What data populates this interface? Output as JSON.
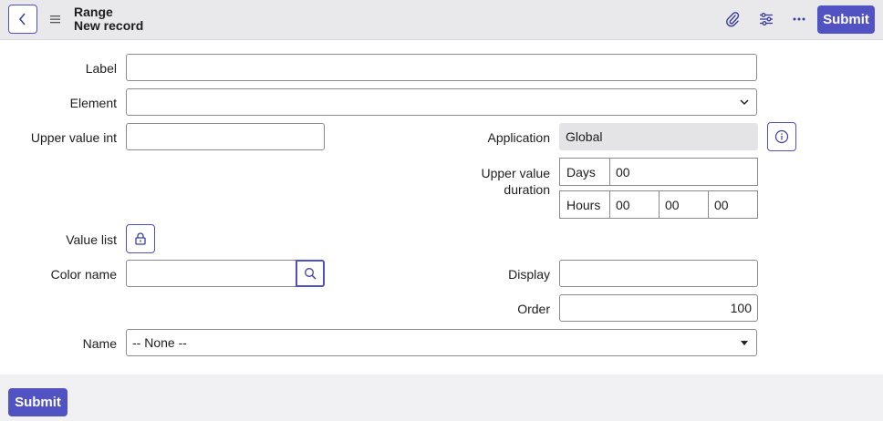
{
  "header": {
    "title": "Range",
    "subtitle": "New record",
    "submit_label": "Submit",
    "icons": [
      "chevron-left-icon",
      "hamburger-menu-icon",
      "paperclip-icon",
      "sliders-icon",
      "more-icon"
    ]
  },
  "form": {
    "label_field": {
      "label": "Label",
      "value": ""
    },
    "element_field": {
      "label": "Element",
      "value": ""
    },
    "upper_value_int": {
      "label": "Upper value int",
      "value": ""
    },
    "application": {
      "label": "Application",
      "value": "Global"
    },
    "upper_value_duration": {
      "label_line1": "Upper value",
      "label_line2": "duration",
      "days_label": "Days",
      "days_value": "00",
      "hours_label": "Hours",
      "hours_value": "00",
      "minutes_value": "00",
      "seconds_value": "00"
    },
    "value_list": {
      "label": "Value list"
    },
    "color_name": {
      "label": "Color name",
      "value": ""
    },
    "display": {
      "label": "Display",
      "value": ""
    },
    "order": {
      "label": "Order",
      "value": "100"
    },
    "name": {
      "label": "Name",
      "value": "-- None --"
    }
  },
  "footer": {
    "submit_label": "Submit"
  },
  "colors": {
    "accent": "#5253c3",
    "header_bg": "#e9e9ec",
    "readonly_bg": "#e4e4e7"
  }
}
